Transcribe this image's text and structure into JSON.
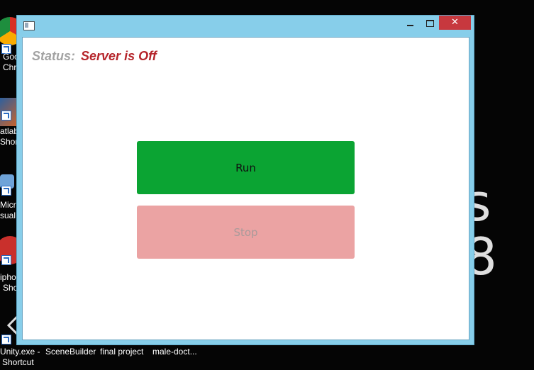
{
  "desktop": {
    "icons": [
      {
        "name": "chrome",
        "label_lines": [
          "Goo",
          "Chro"
        ],
        "color": "#2e9d4a"
      },
      {
        "name": "matlab",
        "label_lines": [
          "atlab",
          "Shor"
        ],
        "color": "#e0631a"
      },
      {
        "name": "visual-studio",
        "label_lines": [
          "Micro",
          "sual"
        ],
        "color": "#6fa3d8"
      },
      {
        "name": "photoshop",
        "label_lines": [
          "ipho",
          "Sho"
        ],
        "color": "#c9302c"
      },
      {
        "name": "unity",
        "label_lines": [
          "Unity.exe -",
          "Shortcut"
        ],
        "color": "#dddddd"
      }
    ],
    "taskbar_labels": [
      "SceneBuilder",
      "final project",
      "male-doct..."
    ],
    "wallpaper_text": "s 8"
  },
  "window": {
    "controls": {
      "minimize": "minimize",
      "maximize": "maximize",
      "close": "✕"
    },
    "status": {
      "label": "Status:",
      "value": "Server is Off"
    },
    "buttons": {
      "run": "Run",
      "stop": "Stop"
    },
    "colors": {
      "run": "#0ba433",
      "stop": "#eba3a3",
      "status_off": "#b5242a",
      "frame": "#87ceea"
    }
  }
}
